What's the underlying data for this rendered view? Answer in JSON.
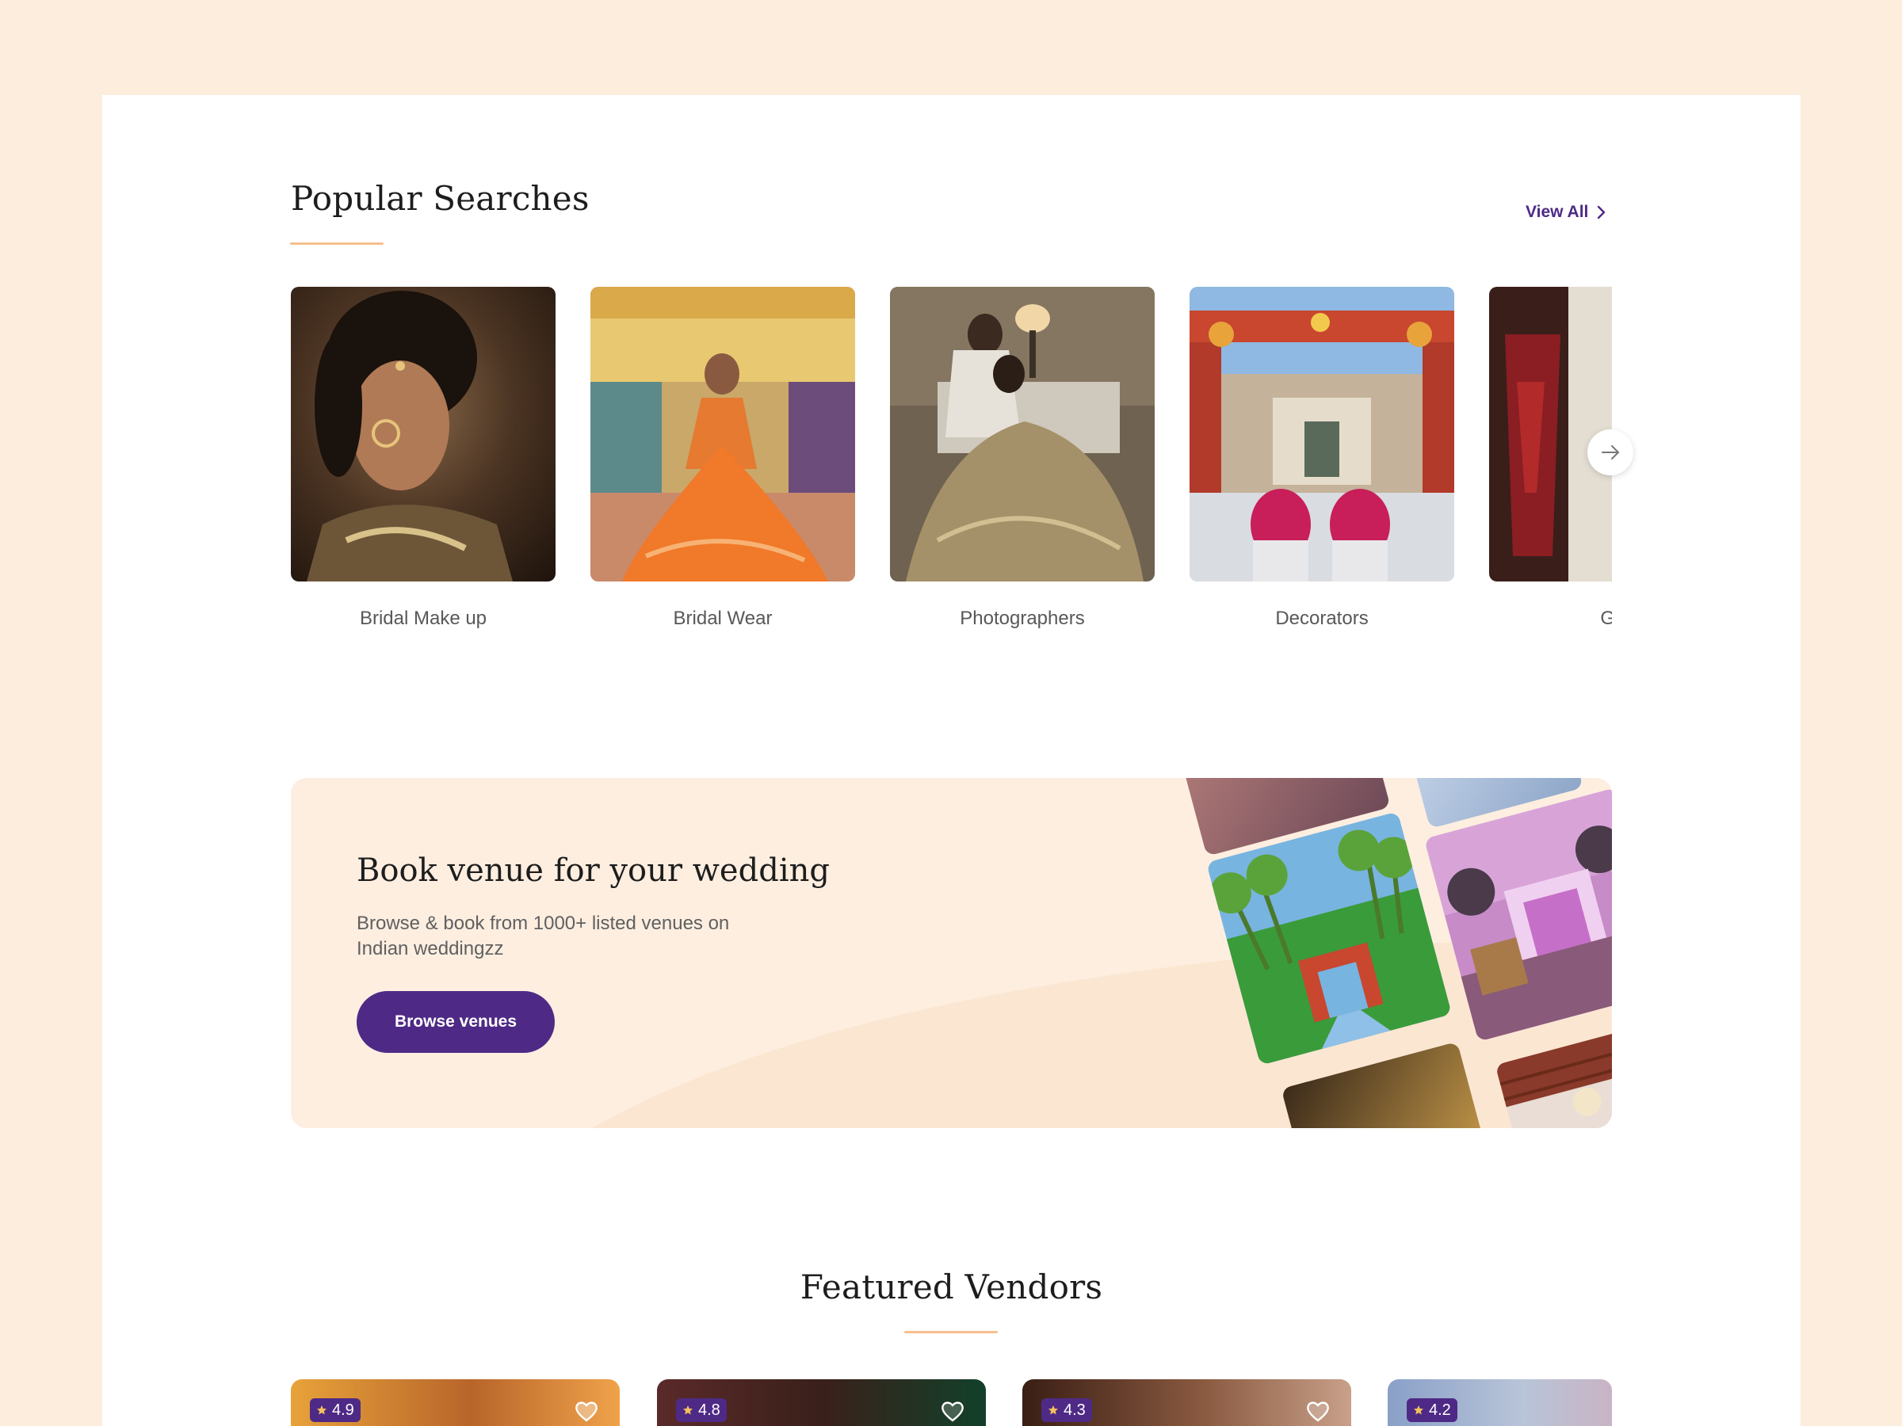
{
  "popular_searches": {
    "title": "Popular Searches",
    "view_all": "View All",
    "categories": [
      {
        "label": "Bridal Make up"
      },
      {
        "label": "Bridal Wear"
      },
      {
        "label": "Photographers"
      },
      {
        "label": "Decorators"
      },
      {
        "label": "Groo"
      }
    ]
  },
  "venue_banner": {
    "title": "Book venue for your wedding",
    "subtitle": "Browse & book from 1000+ listed venues on Indian weddingzz",
    "button": "Browse venues"
  },
  "featured_vendors": {
    "title": "Featured Vendors",
    "vendors": [
      {
        "rating": "4.9"
      },
      {
        "rating": "4.8"
      },
      {
        "rating": "4.3"
      },
      {
        "rating": "4.2"
      }
    ]
  },
  "colors": {
    "page_bg": "#fdeddd",
    "accent": "#4e2a86",
    "underline": "#f7bf8e",
    "banner_bg": "#fdeee0"
  }
}
